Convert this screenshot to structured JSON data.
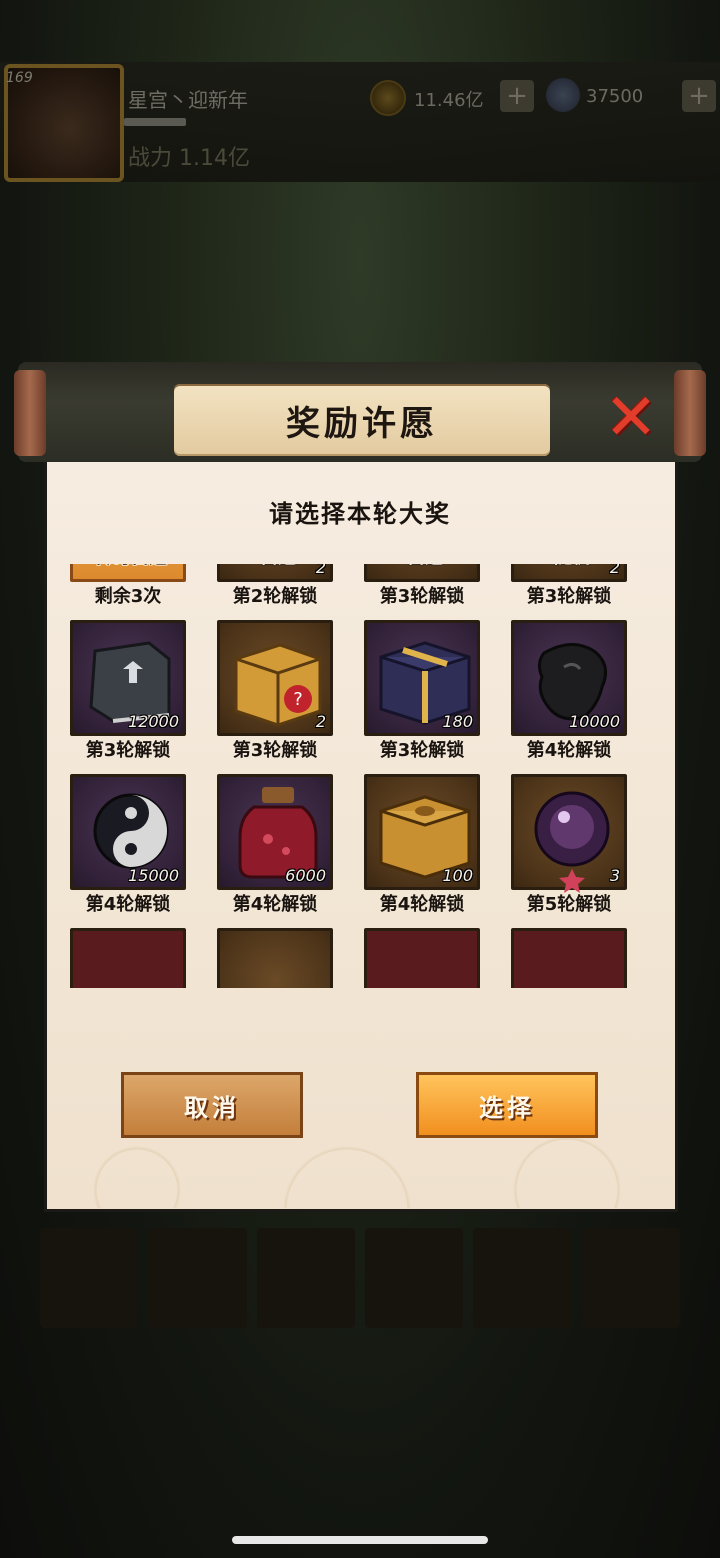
{
  "background": {
    "level": "169",
    "player_name": "星宫丶迎新年",
    "power": "战力 1.14亿",
    "coins": "11.46亿",
    "gems": "37500",
    "plus": "+"
  },
  "dialog": {
    "title": "奖励许愿",
    "close_symbol": "✕",
    "subtitle": "请选择本轮大奖",
    "items": [
      {
        "icon": "legendary-choice-chest-icon",
        "tile": "orange",
        "tag": "传奇自选",
        "count": "",
        "unlock": "剩余3次"
      },
      {
        "icon": "choice-chest-icon",
        "tile": "brown",
        "tag": "自选",
        "count": "2",
        "unlock": "第2轮解锁"
      },
      {
        "icon": "gold-choice-chest-icon",
        "tile": "brown",
        "tag": "自选",
        "count": "",
        "unlock": "第3轮解锁"
      },
      {
        "icon": "random-chest-icon",
        "tile": "brown",
        "tag": "随机",
        "count": "2",
        "unlock": "第3轮解锁"
      },
      {
        "icon": "book-icon",
        "tile": "purple",
        "tag": "",
        "count": "12000",
        "unlock": "第3轮解锁"
      },
      {
        "icon": "mystery-box-icon",
        "tile": "brown",
        "tag": "",
        "count": "2",
        "unlock": "第3轮解锁"
      },
      {
        "icon": "blue-gift-box-icon",
        "tile": "purple",
        "tag": "",
        "count": "180",
        "unlock": "第3轮解锁"
      },
      {
        "icon": "black-stone-icon",
        "tile": "purple",
        "tag": "",
        "count": "10000",
        "unlock": "第4轮解锁"
      },
      {
        "icon": "yin-yang-icon",
        "tile": "purple",
        "tag": "",
        "count": "15000",
        "unlock": "第4轮解锁"
      },
      {
        "icon": "red-potion-jar-icon",
        "tile": "purple",
        "tag": "",
        "count": "6000",
        "unlock": "第4轮解锁"
      },
      {
        "icon": "golden-box-icon",
        "tile": "brown",
        "tag": "",
        "count": "100",
        "unlock": "第4轮解锁"
      },
      {
        "icon": "purple-orb-icon",
        "tile": "brown",
        "tag": "",
        "count": "3",
        "unlock": "第5轮解锁"
      },
      {
        "icon": "partial-item-icon",
        "tile": "maroon",
        "tag": "",
        "count": "",
        "unlock": ""
      },
      {
        "icon": "partial-item-icon",
        "tile": "brown",
        "tag": "",
        "count": "",
        "unlock": ""
      },
      {
        "icon": "partial-item-icon",
        "tile": "maroon",
        "tag": "",
        "count": "",
        "unlock": ""
      },
      {
        "icon": "partial-item-icon",
        "tile": "maroon",
        "tag": "",
        "count": "",
        "unlock": ""
      }
    ],
    "cancel_label": "取消",
    "select_label": "选择"
  }
}
